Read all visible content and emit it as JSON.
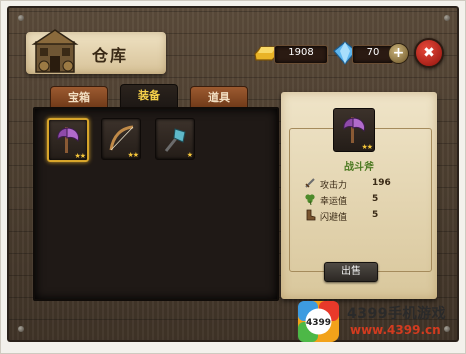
{
  "window": {
    "title": "仓库"
  },
  "currency": {
    "gold": "1908",
    "gems": "70"
  },
  "tabs": [
    {
      "label": "宝箱",
      "active": false
    },
    {
      "label": "装备",
      "active": true
    },
    {
      "label": "道具",
      "active": false
    }
  ],
  "inventory": {
    "items": [
      {
        "icon": "battle-axe-icon",
        "stars": "★★",
        "selected": true
      },
      {
        "icon": "bow-icon",
        "stars": "★★",
        "selected": false
      },
      {
        "icon": "shovel-axe-icon",
        "stars": "★",
        "selected": false
      }
    ]
  },
  "detail": {
    "icon": "battle-axe-icon",
    "stars": "★★",
    "name": "战斗斧",
    "stats": [
      {
        "icon": "sword-icon",
        "label": "攻击力",
        "value": "196"
      },
      {
        "icon": "clover-icon",
        "label": "幸运值",
        "value": "5"
      },
      {
        "icon": "boot-icon",
        "label": "闪避值",
        "value": "5"
      }
    ],
    "sell_label": "出售"
  },
  "watermark": {
    "badge": "4399",
    "line1": "4399手机游戏",
    "line2": "www.4399.cn"
  },
  "colors": {
    "accent": "#f6d14a",
    "item_name": "#4d7a22",
    "close": "#c9231a"
  }
}
